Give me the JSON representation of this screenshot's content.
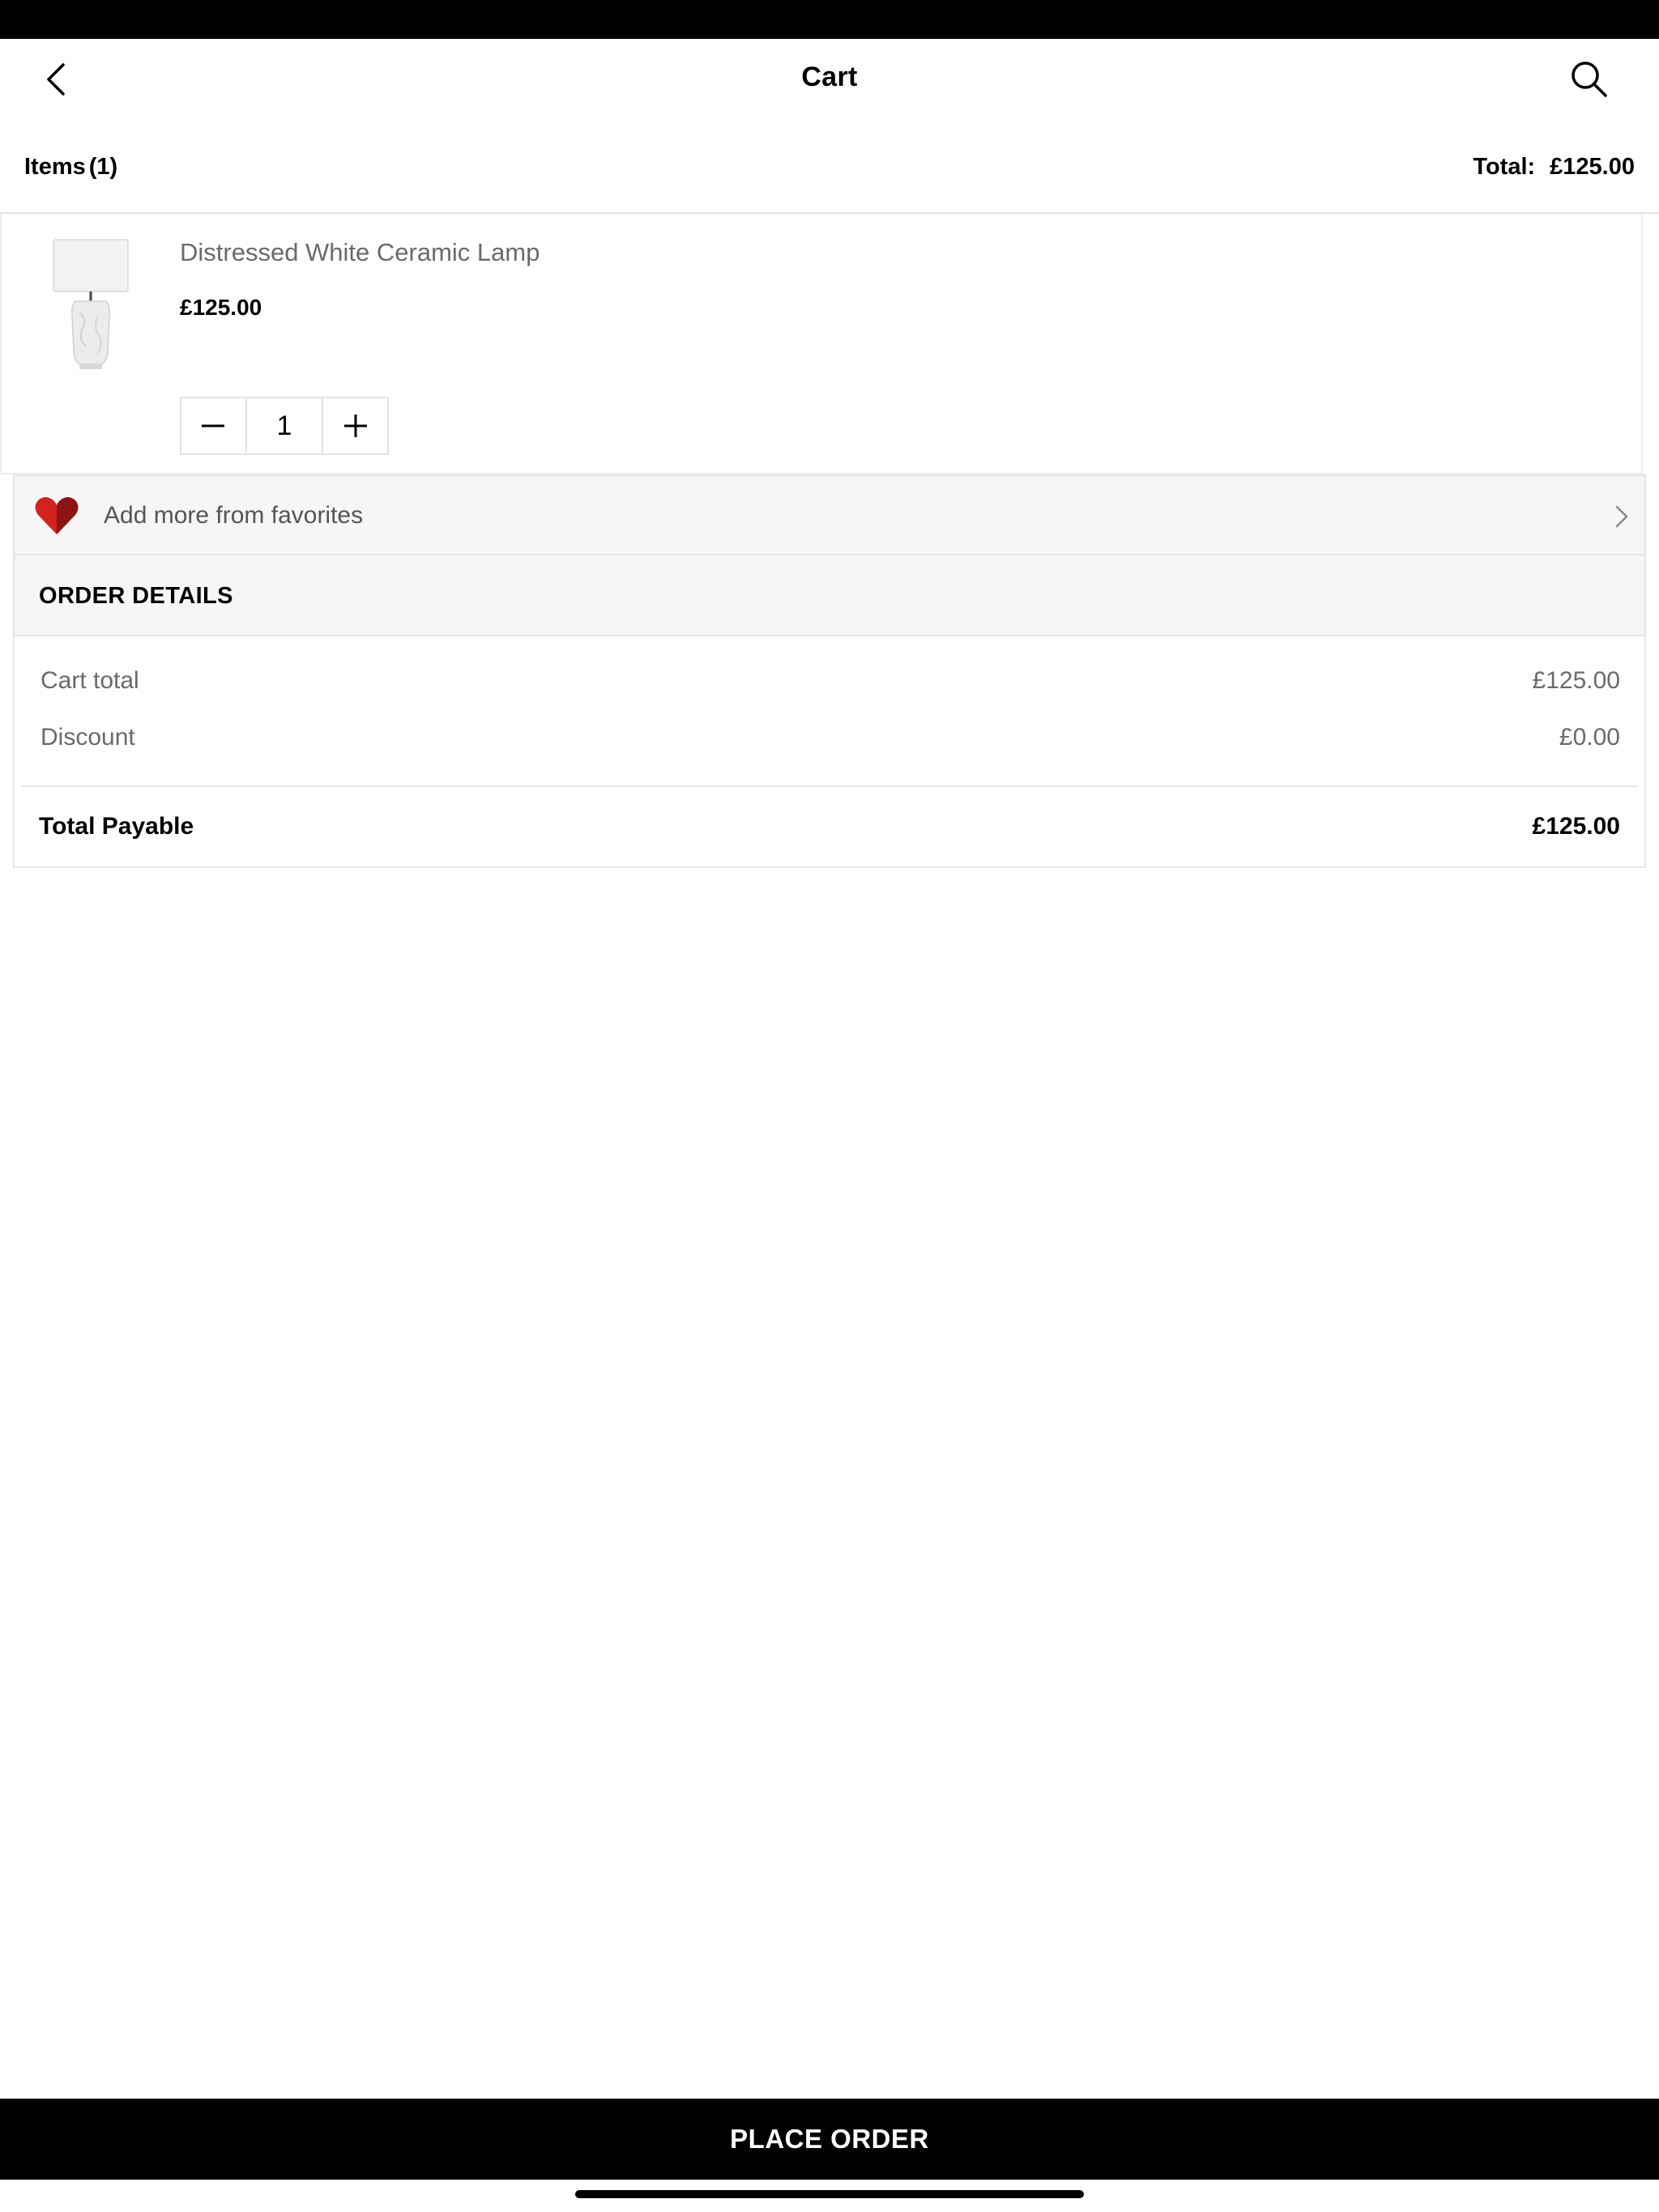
{
  "nav": {
    "title": "Cart",
    "back_icon": "chevron-left-icon",
    "search_icon": "search-icon"
  },
  "summary": {
    "items_label": "Items",
    "items_count": "(1)",
    "total_label": "Total:",
    "total_value": "£125.00"
  },
  "cart_items": [
    {
      "name": "Distressed White Ceramic Lamp",
      "price": "£125.00",
      "quantity": "1",
      "thumbnail_icon": "lamp-image"
    }
  ],
  "favorites": {
    "label": "Add more from favorites",
    "icon": "heart-icon"
  },
  "order_details": {
    "title": "ORDER DETAILS",
    "lines": [
      {
        "label": "Cart total",
        "value": "£125.00"
      },
      {
        "label": "Discount",
        "value": "£0.00"
      }
    ],
    "payable_label": "Total Payable",
    "payable_value": "£125.00"
  },
  "footer": {
    "place_order_label": "PLACE ORDER"
  },
  "colors": {
    "bar": "#000000",
    "panel": "#f6f6f6",
    "heart_light": "#d3231f",
    "heart_dark": "#8e1414"
  }
}
